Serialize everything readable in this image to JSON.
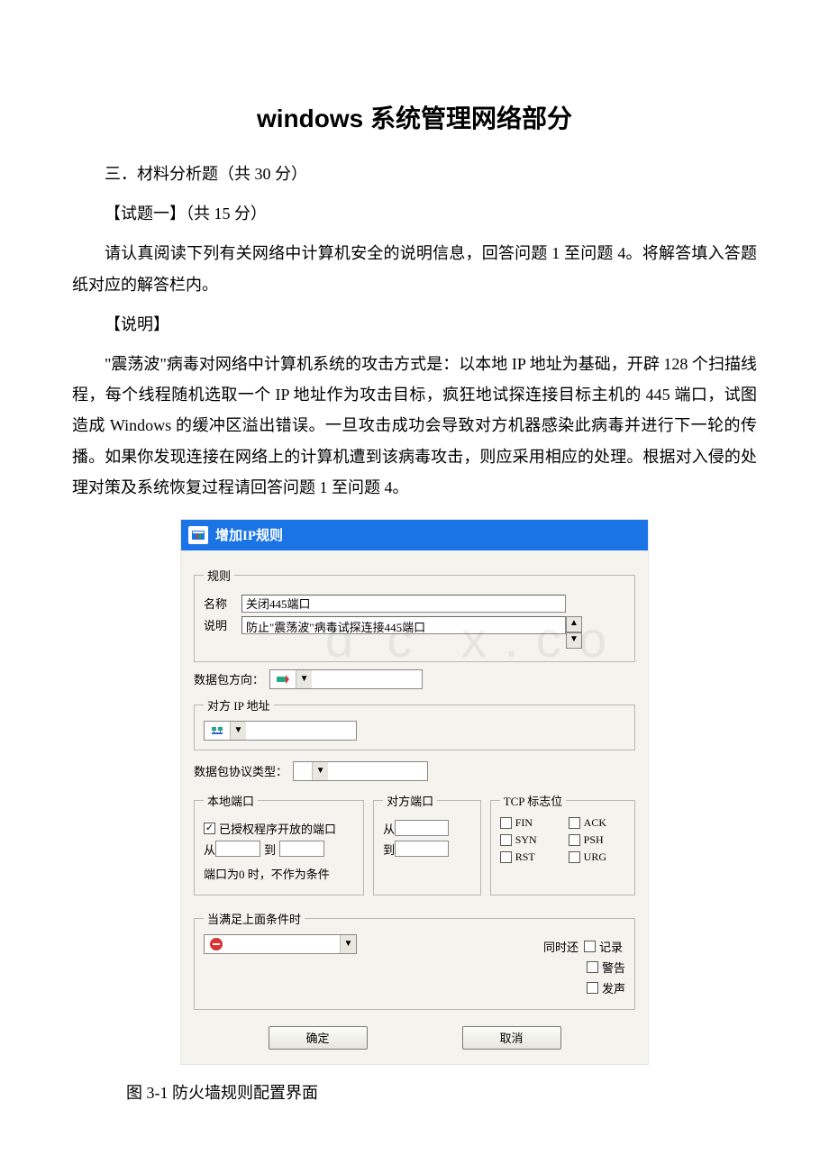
{
  "title": "windows 系统管理网络部分",
  "paragraphs": {
    "section_heading": "三．材料分析题（共 30 分）",
    "question_heading": "【试题一】（共 15 分）",
    "intro": "请认真阅读下列有关网络中计算机安全的说明信息，回答问题 1 至问题 4。将解答填入答题纸对应的解答栏内。",
    "shuoming_label": "【说明】",
    "shuoming_body": "\"震荡波\"病毒对网络中计算机系统的攻击方式是：以本地 IP 地址为基础，开辟 128 个扫描线程，每个线程随机选取一个 IP 地址作为攻击目标，疯狂地试探连接目标主机的 445 端口，试图造成 Windows 的缓冲区溢出错误。一旦攻击成功会导致对方机器感染此病毒并进行下一轮的传播。如果你发现连接在网络上的计算机遭到该病毒攻击，则应采用相应的处理。根据对入侵的处理对策及系统恢复过程请回答问题 1 至问题 4。"
  },
  "dialog": {
    "title": "增加IP规则",
    "group_rule": {
      "legend": "规则",
      "name_label": "名称",
      "name_value": "关闭445端口",
      "desc_label": "说明",
      "desc_value": "防止\"震荡波\"病毒试探连接445端口"
    },
    "direction_label": "数据包方向：",
    "ip_group_legend": "对方 IP 地址",
    "protocol_label": "数据包协议类型：",
    "local_port": {
      "legend": "本地端口",
      "authorized_label": "已授权程序开放的端口",
      "from_label": "从",
      "to_label": "到",
      "note": "端口为0 时，不作为条件"
    },
    "remote_port": {
      "legend": "对方端口",
      "from_label": "从",
      "to_label": "到"
    },
    "tcp_flags": {
      "legend": "TCP 标志位",
      "fin": "FIN",
      "ack": "ACK",
      "syn": "SYN",
      "psh": "PSH",
      "rst": "RST",
      "urg": "URG"
    },
    "condition": {
      "legend": "当满足上面条件时",
      "also_label": "同时还",
      "log": "记录",
      "alert": "警告",
      "sound": "发声"
    },
    "buttons": {
      "ok": "确定",
      "cancel": "取消"
    }
  },
  "caption": "图 3-1 防火墙规则配置界面"
}
